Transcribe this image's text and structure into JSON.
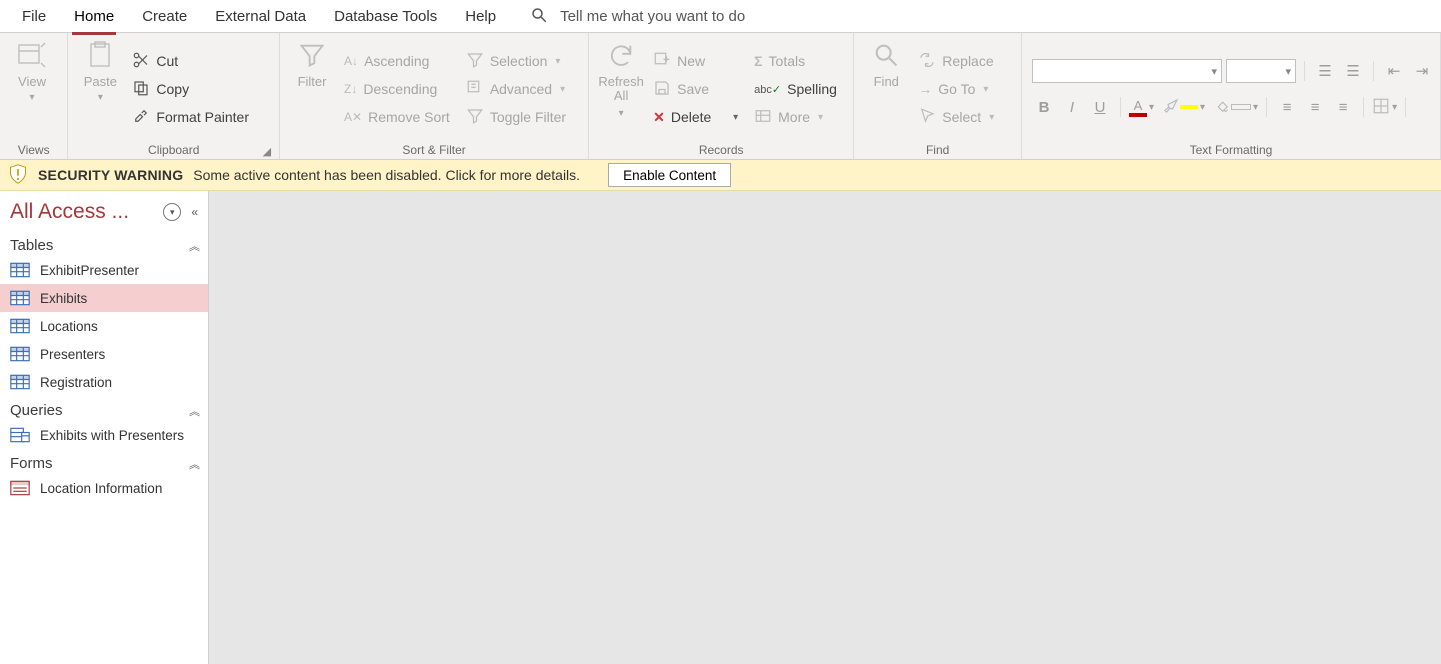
{
  "tabs": {
    "file": "File",
    "home": "Home",
    "create": "Create",
    "external": "External Data",
    "tools": "Database Tools",
    "help": "Help"
  },
  "tellme_placeholder": "Tell me what you want to do",
  "ribbon": {
    "views": {
      "view": "View",
      "group": "Views"
    },
    "clipboard": {
      "paste": "Paste",
      "cut": "Cut",
      "copy": "Copy",
      "format_painter": "Format Painter",
      "group": "Clipboard"
    },
    "sort": {
      "filter": "Filter",
      "asc": "Ascending",
      "desc": "Descending",
      "remove": "Remove Sort",
      "selection": "Selection",
      "advanced": "Advanced",
      "toggle": "Toggle Filter",
      "group": "Sort & Filter"
    },
    "records": {
      "refresh": "Refresh\nAll",
      "new": "New",
      "save": "Save",
      "delete": "Delete",
      "totals": "Totals",
      "spelling": "Spelling",
      "more": "More",
      "group": "Records"
    },
    "find": {
      "find": "Find",
      "replace": "Replace",
      "goto": "Go To",
      "select": "Select",
      "group": "Find"
    },
    "format": {
      "group": "Text Formatting"
    }
  },
  "security": {
    "title": "SECURITY WARNING",
    "msg": "Some active content has been disabled. Click for more details.",
    "button": "Enable Content"
  },
  "nav": {
    "title": "All Access ...",
    "cats": {
      "tables": "Tables",
      "queries": "Queries",
      "forms": "Forms"
    },
    "tables": [
      "ExhibitPresenter",
      "Exhibits",
      "Locations",
      "Presenters",
      "Registration"
    ],
    "tables_selected": 1,
    "queries": [
      "Exhibits with Presenters"
    ],
    "forms": [
      "Location Information"
    ]
  }
}
